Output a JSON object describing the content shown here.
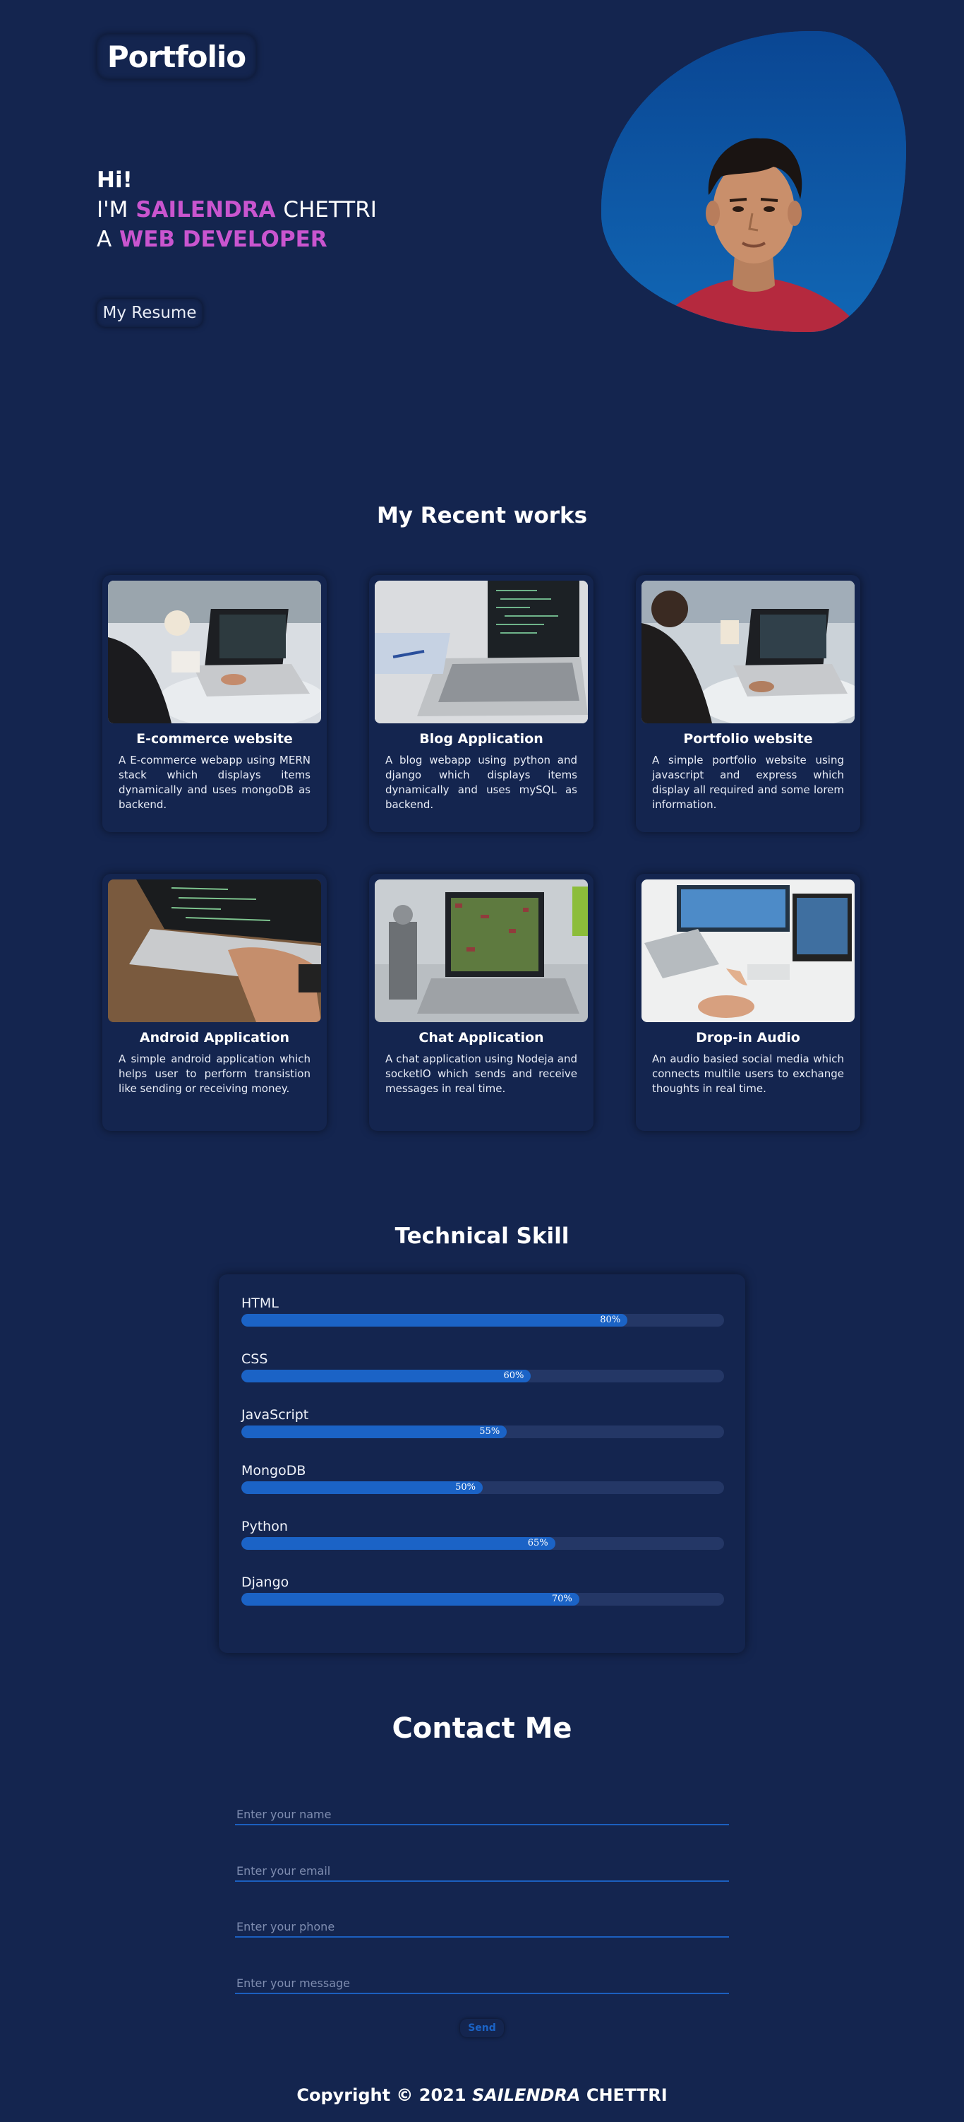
{
  "header": {
    "logo": "Portfolio"
  },
  "hero": {
    "greeting": "Hi!",
    "im_prefix": "I'M",
    "first_name": "SAILENDRA",
    "last_name": "CHETTRI",
    "role_prefix": "A",
    "role": "WEB DEVELOPER",
    "resume_button": "My Resume"
  },
  "works": {
    "title": "My Recent works",
    "items": [
      {
        "title": "E-commerce website",
        "description": "A E-commerce webapp using MERN stack which displays items dynamically and uses mongoDB as backend."
      },
      {
        "title": "Blog Application",
        "description": "A blog webapp using python and django which displays items dynamically and uses mySQL as backend."
      },
      {
        "title": "Portfolio website",
        "description": "A simple portfolio website using javascript and express which display all required and some lorem information."
      },
      {
        "title": "Android Application",
        "description": "A simple android application which helps user to perform transistion like sending or receiving money."
      },
      {
        "title": "Chat Application",
        "description": "A chat application using Nodeja and socketIO which sends and receive messages in real time."
      },
      {
        "title": "Drop-in Audio",
        "description": "An audio basied social media which connects multile users to exchange thoughts in real time."
      }
    ]
  },
  "skills": {
    "title": "Technical Skill",
    "items": [
      {
        "name": "HTML",
        "percent": 80,
        "label": "80%"
      },
      {
        "name": "CSS",
        "percent": 60,
        "label": "60%"
      },
      {
        "name": "JavaScript",
        "percent": 55,
        "label": "55%"
      },
      {
        "name": "MongoDB",
        "percent": 50,
        "label": "50%"
      },
      {
        "name": "Python",
        "percent": 65,
        "label": "65%"
      },
      {
        "name": "Django",
        "percent": 70,
        "label": "70%"
      }
    ]
  },
  "contact": {
    "title": "Contact Me",
    "name_placeholder": "Enter your name",
    "email_placeholder": "Enter your email",
    "phone_placeholder": "Enter your phone",
    "message_placeholder": "Enter your message",
    "send_label": "Send"
  },
  "footer": {
    "prefix": "Copyright © 2021",
    "name_italic": "SAILENDRA",
    "name_rest": "CHETTRI"
  },
  "colors": {
    "background": "#14254f",
    "accent": "#c955cf",
    "primary_blue": "#1b63c6"
  }
}
